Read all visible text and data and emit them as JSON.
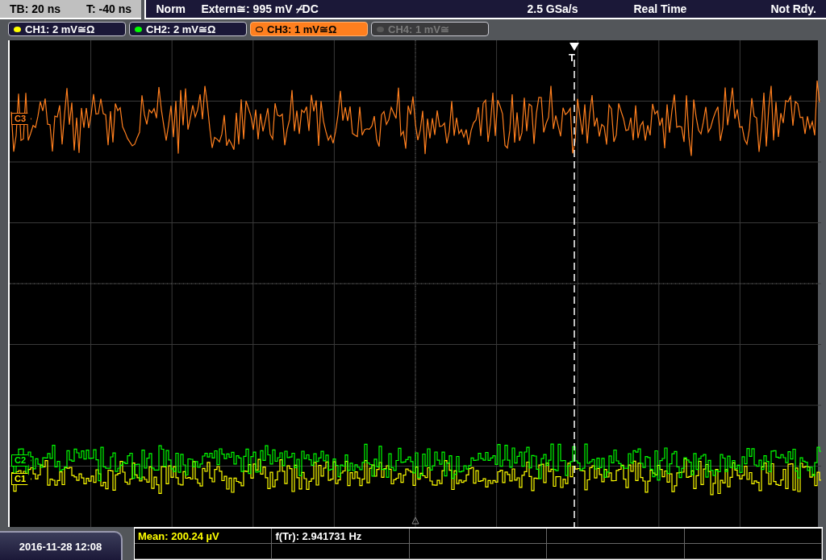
{
  "timebase": {
    "tb": "TB: 20 ns",
    "t": "T: -40 ns"
  },
  "status": {
    "mode": "Norm",
    "trigger": "Extern≅: 995 mV ⌿DC",
    "sample_rate": "2.5 GSa/s",
    "acquisition": "Real Time",
    "state": "Not Rdy."
  },
  "channels": [
    {
      "label": "CH1: 2 mV≅Ω",
      "color": "#ffff00",
      "selected": false,
      "enabled": true
    },
    {
      "label": "CH2: 2 mV≅Ω",
      "color": "#00ff00",
      "selected": false,
      "enabled": true
    },
    {
      "label": "CH3: 1 mV≅Ω",
      "color": "#ff7f1e",
      "selected": true,
      "enabled": true
    },
    {
      "label": "CH4: 1 mV≅",
      "color": "#5a5a5a",
      "selected": false,
      "enabled": false
    }
  ],
  "markers": [
    {
      "label": "C3",
      "color": "#ff7f1e"
    },
    {
      "label": "C2",
      "color": "#00ff00"
    },
    {
      "label": "C1",
      "color": "#ffff00"
    }
  ],
  "trigger_marker": "T",
  "measurements": [
    {
      "text": "Mean: 200.24 µV",
      "highlighted": true
    },
    {
      "text": "f(Tr): 2.941731 Hz",
      "highlighted": false
    }
  ],
  "datetime": "2016-11-28 12:08"
}
